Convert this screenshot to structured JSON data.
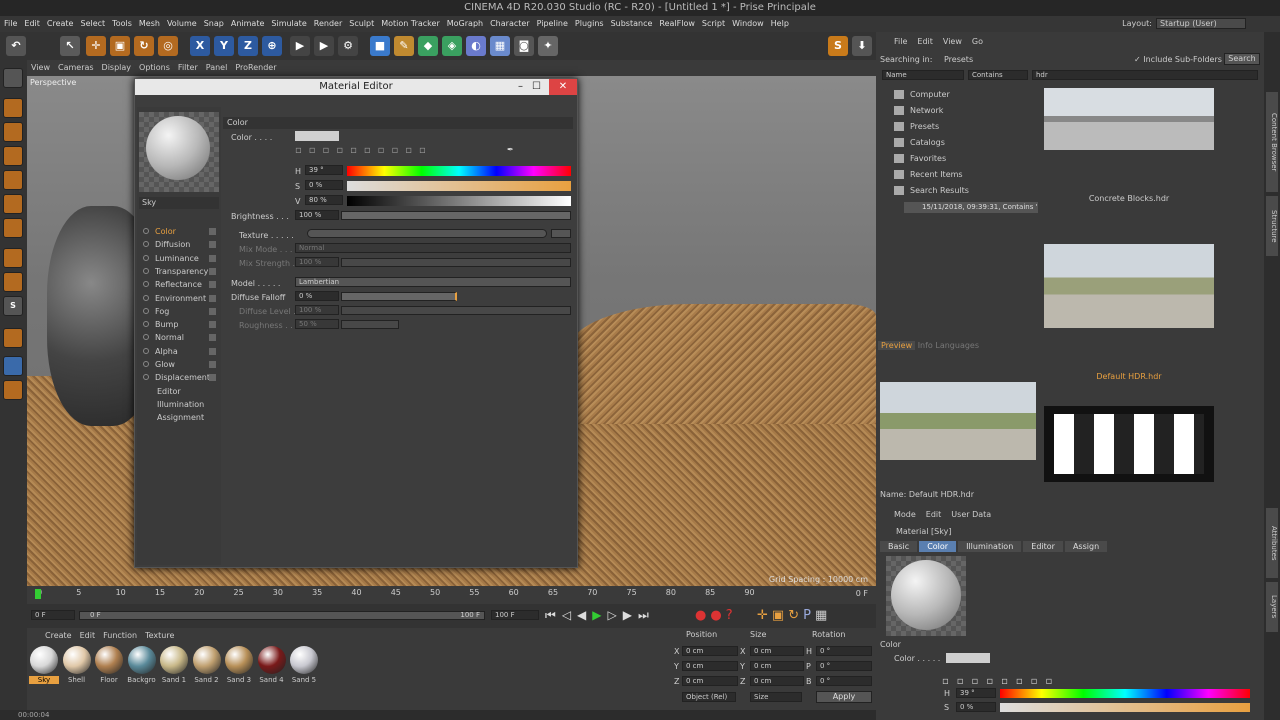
{
  "app": {
    "title": "CINEMA 4D R20.030 Studio (RC - R20) - [Untitled 1 *] - Prise Principale",
    "menu": [
      "File",
      "Edit",
      "Create",
      "Select",
      "Tools",
      "Mesh",
      "Volume",
      "Snap",
      "Animate",
      "Simulate",
      "Render",
      "Sculpt",
      "Motion Tracker",
      "MoGraph",
      "Character",
      "Pipeline",
      "Plugins",
      "Substance",
      "RealFlow",
      "Script",
      "Window",
      "Help"
    ],
    "layout_label": "Layout:",
    "layout_value": "Startup (User)"
  },
  "viewport": {
    "menu": [
      "View",
      "Cameras",
      "Display",
      "Options",
      "Filter",
      "Panel",
      "ProRender"
    ],
    "label": "Perspective",
    "grid_spacing": "Grid Spacing : 10000 cm"
  },
  "timeline": {
    "ticks": [
      "0",
      "5",
      "10",
      "15",
      "20",
      "25",
      "30",
      "35",
      "40",
      "45",
      "50",
      "55",
      "60",
      "65",
      "70",
      "75",
      "80",
      "85",
      "90"
    ],
    "end_label": "0 F",
    "start_field": "0 F",
    "current_field": "0 F",
    "max_field": "100 F",
    "end_field": "100 F"
  },
  "material_manager": {
    "menu": [
      "Create",
      "Edit",
      "Function",
      "Texture"
    ],
    "materials": [
      {
        "name": "Sky",
        "color": "#d8d8d8",
        "selected": true
      },
      {
        "name": "Shell",
        "color": "#e0c8a8"
      },
      {
        "name": "Floor",
        "color": "#b08050"
      },
      {
        "name": "Backgro",
        "color": "#5a8a9a"
      },
      {
        "name": "Sand 1",
        "color": "#c8b888"
      },
      {
        "name": "Sand 2",
        "color": "#c0a070"
      },
      {
        "name": "Sand 3",
        "color": "#b89058"
      },
      {
        "name": "Sand 4",
        "color": "#7a1a1a"
      },
      {
        "name": "Sand 5",
        "color": "#c8c8d0"
      }
    ]
  },
  "coords": {
    "headers": [
      "Position",
      "Size",
      "Rotation"
    ],
    "rows": [
      {
        "a": "X",
        "v1": "0 cm",
        "b": "X",
        "v2": "0 cm",
        "c": "H",
        "v3": "0 °"
      },
      {
        "a": "Y",
        "v1": "0 cm",
        "b": "Y",
        "v2": "0 cm",
        "c": "P",
        "v3": "0 °"
      },
      {
        "a": "Z",
        "v1": "0 cm",
        "b": "Z",
        "v2": "0 cm",
        "c": "B",
        "v3": "0 °"
      }
    ],
    "mode": "Object (Rel)",
    "size_mode": "Size",
    "apply": "Apply"
  },
  "status": {
    "time": "00:00:04"
  },
  "content_browser": {
    "menu": [
      "File",
      "Edit",
      "View",
      "Go"
    ],
    "searching_in": "Searching in:",
    "location": "Presets",
    "include_sub": "Include Sub-Folders",
    "search_btn": "Search",
    "filter_field": "Name",
    "filter_op": "Contains",
    "filter_value": "hdr",
    "tree": [
      "Computer",
      "Network",
      "Presets",
      "Catalogs",
      "Favorites",
      "Recent Items",
      "Search Results"
    ],
    "search_result": "15/11/2018, 09:39:31, Contains 'hdr'",
    "thumbs": [
      {
        "name": "Concrete Blocks.hdr"
      },
      {
        "name": "Default HDR.hdr"
      }
    ],
    "preview_tabs": [
      "Preview",
      "Info",
      "Languages"
    ],
    "preview_name": "Name: Default HDR.hdr"
  },
  "attributes": {
    "menu": [
      "Mode",
      "Edit",
      "User Data"
    ],
    "object": "Material [Sky]",
    "tabs": [
      "Basic",
      "Color",
      "Illumination",
      "Editor",
      "Assign"
    ],
    "active_tab": "Color",
    "section": "Color",
    "color_label": "Color . . . . .",
    "h_label": "H",
    "h_value": "39 °",
    "s_label": "S",
    "s_value": "0 %"
  },
  "material_editor": {
    "title": "Material Editor",
    "name": "Sky",
    "channels": [
      "Color",
      "Diffusion",
      "Luminance",
      "Transparency",
      "Reflectance",
      "Environment",
      "Fog",
      "Bump",
      "Normal",
      "Alpha",
      "Glow",
      "Displacement",
      "Editor",
      "Illumination",
      "Assignment"
    ],
    "section": "Color",
    "color_label": "Color . . . .",
    "h": "39 °",
    "s": "0 %",
    "v": "80 %",
    "brightness_label": "Brightness . . .",
    "brightness": "100 %",
    "texture_label": "Texture . . . . .",
    "mix_mode_label": "Mix Mode . . .",
    "mix_mode": "Normal",
    "mix_strength_label": "Mix Strength . .",
    "mix_strength": "100 %",
    "model_label": "Model . . . . .",
    "model": "Lambertian",
    "diffuse_falloff_label": "Diffuse Falloff",
    "diffuse_falloff": "0 %",
    "diffuse_level_label": "Diffuse Level . .",
    "diffuse_level": "100 %",
    "roughness_label": "Roughness . . .",
    "roughness": "50 %"
  },
  "right_strip": [
    "Content Browser",
    "Structure",
    "Attributes",
    "Layers"
  ]
}
